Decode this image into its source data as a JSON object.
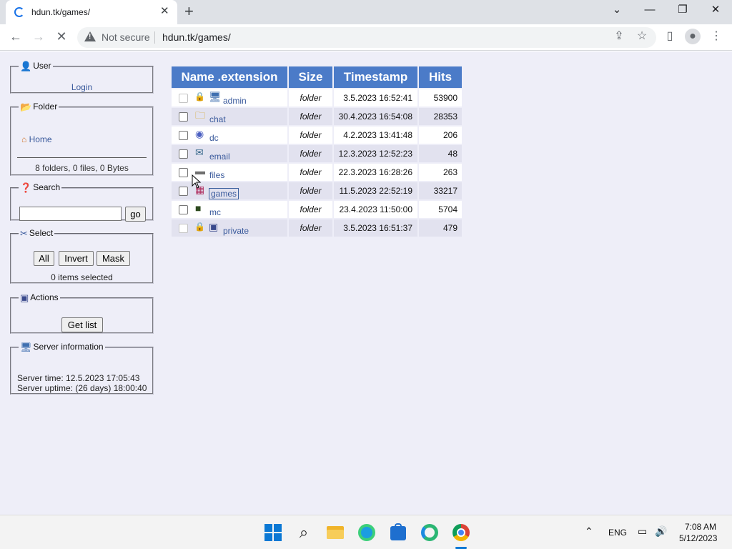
{
  "browser": {
    "tab_title": "hdun.tk/games/",
    "tab_close": "✕",
    "new_tab": "+",
    "not_secure": "Not secure",
    "url": "hdun.tk/games/"
  },
  "sidebar": {
    "user": {
      "legend": "User",
      "login": "Login"
    },
    "folder": {
      "legend": "Folder",
      "home": "Home",
      "stats": "8 folders, 0 files, 0 Bytes"
    },
    "search": {
      "legend": "Search",
      "go": "go"
    },
    "select": {
      "legend": "Select",
      "all": "All",
      "invert": "Invert",
      "mask": "Mask",
      "count": "0 items selected"
    },
    "actions": {
      "legend": "Actions",
      "get_list": "Get list"
    },
    "server": {
      "legend": "Server information",
      "time": "Server time: 12.5.2023 17:05:43",
      "uptime": "Server uptime: (26 days) 18:00:40"
    }
  },
  "table": {
    "headers": [
      "Name .extension",
      "Size",
      "Timestamp",
      "Hits"
    ],
    "rows": [
      {
        "name": "admin",
        "size": "folder",
        "timestamp": "3.5.2023 16:52:41",
        "hits": "53900",
        "locked": true,
        "icon": "computer-icon"
      },
      {
        "name": "chat",
        "size": "folder",
        "timestamp": "30.4.2023 16:54:08",
        "hits": "28353",
        "locked": false,
        "icon": "folder-icon"
      },
      {
        "name": "dc",
        "size": "folder",
        "timestamp": "4.2.2023 13:41:48",
        "hits": "206",
        "locked": false,
        "icon": "disc-icon"
      },
      {
        "name": "email",
        "size": "folder",
        "timestamp": "12.3.2023 12:52:23",
        "hits": "48",
        "locked": false,
        "icon": "mail-icon"
      },
      {
        "name": "files",
        "size": "folder",
        "timestamp": "22.3.2023 16:28:26",
        "hits": "263",
        "locked": false,
        "icon": "drive-icon"
      },
      {
        "name": "games",
        "size": "folder",
        "timestamp": "11.5.2023 22:52:19",
        "hits": "33217",
        "locked": false,
        "icon": "games-icon"
      },
      {
        "name": "mc",
        "size": "folder",
        "timestamp": "23.4.2023 11:50:00",
        "hits": "5704",
        "locked": false,
        "icon": "block-icon"
      },
      {
        "name": "private",
        "size": "folder",
        "timestamp": "3.5.2023 16:51:37",
        "hits": "479",
        "locked": true,
        "icon": "floppy-icon"
      }
    ]
  },
  "taskbar": {
    "lang": "ENG",
    "time": "7:08 AM",
    "date": "5/12/2023"
  },
  "colors": {
    "header_bg": "#4b7bc8",
    "page_bg": "#eeeef8",
    "link": "#3a5a9c"
  }
}
